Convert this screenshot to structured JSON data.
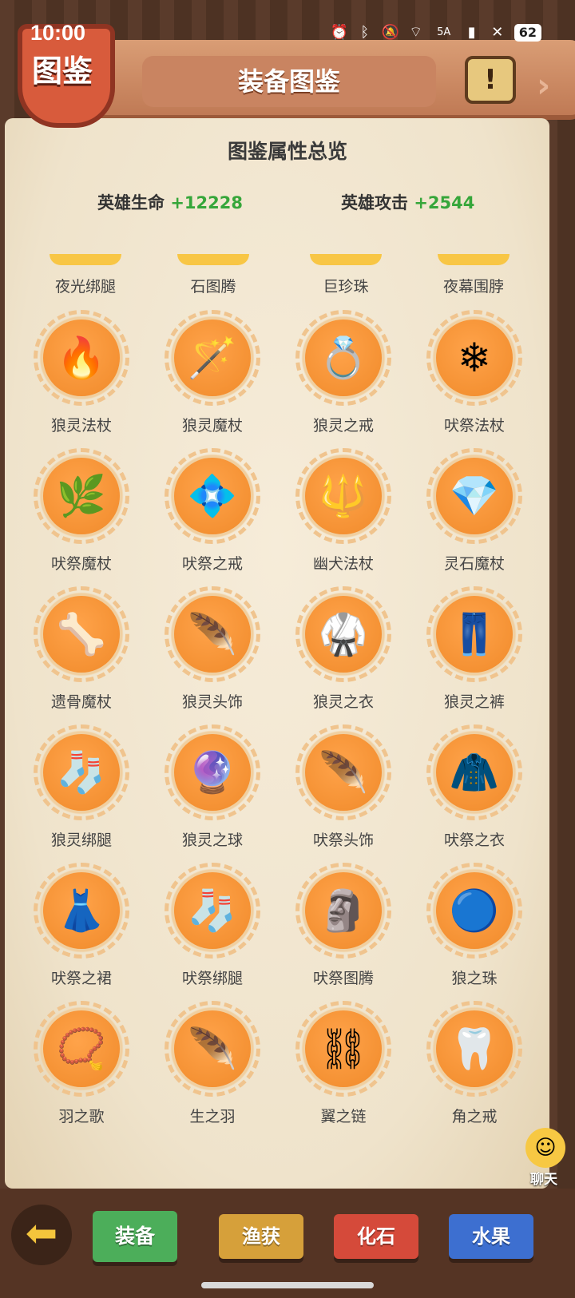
{
  "status_bar": {
    "time": "10:00",
    "network": "5A",
    "battery": "62"
  },
  "header": {
    "badge": "图鉴",
    "title": "装备图鉴",
    "scroll_icon": "!",
    "next_arrow": "›"
  },
  "overview": {
    "title": "图鉴属性总览",
    "hp_label": "英雄生命",
    "hp_value": "+12228",
    "atk_label": "英雄攻击",
    "atk_value": "+2544"
  },
  "top_row": [
    "夜光绑腿",
    "石图腾",
    "巨珍珠",
    "夜幕围脖"
  ],
  "items": [
    {
      "label": "狼灵法杖",
      "icon": "fire-staff-icon",
      "glyph": "🔥"
    },
    {
      "label": "狼灵魔杖",
      "icon": "crystal-wand-icon",
      "glyph": "🪄"
    },
    {
      "label": "狼灵之戒",
      "icon": "fang-ring-icon",
      "glyph": "💍"
    },
    {
      "label": "吠祭法杖",
      "icon": "ice-staff-icon",
      "glyph": "❄"
    },
    {
      "label": "吠祭魔杖",
      "icon": "branch-wand-icon",
      "glyph": "🌿"
    },
    {
      "label": "吠祭之戒",
      "icon": "blue-ring-icon",
      "glyph": "💠"
    },
    {
      "label": "幽犬法杖",
      "icon": "purple-staff-icon",
      "glyph": "🔱"
    },
    {
      "label": "灵石魔杖",
      "icon": "gem-wand-icon",
      "glyph": "💎"
    },
    {
      "label": "遗骨魔杖",
      "icon": "green-staff-icon",
      "glyph": "🦴"
    },
    {
      "label": "狼灵头饰",
      "icon": "wolf-helmet-icon",
      "glyph": "🪶"
    },
    {
      "label": "狼灵之衣",
      "icon": "wolf-robe-icon",
      "glyph": "🥋"
    },
    {
      "label": "狼灵之裤",
      "icon": "wolf-pants-icon",
      "glyph": "👖"
    },
    {
      "label": "狼灵绑腿",
      "icon": "wolf-leggings-icon",
      "glyph": "🧦"
    },
    {
      "label": "狼灵之球",
      "icon": "wolf-orb-icon",
      "glyph": "🔮"
    },
    {
      "label": "吠祭头饰",
      "icon": "ritual-helmet-icon",
      "glyph": "🪶"
    },
    {
      "label": "吠祭之衣",
      "icon": "ritual-robe-icon",
      "glyph": "🧥"
    },
    {
      "label": "吠祭之裙",
      "icon": "ritual-skirt-icon",
      "glyph": "👗"
    },
    {
      "label": "吠祭绑腿",
      "icon": "ritual-leggings-icon",
      "glyph": "🧦"
    },
    {
      "label": "吠祭图腾",
      "icon": "ritual-totem-icon",
      "glyph": "🗿"
    },
    {
      "label": "狼之珠",
      "icon": "wolf-pearl-icon",
      "glyph": "🔵"
    },
    {
      "label": "羽之歌",
      "icon": "feather-necklace-icon",
      "glyph": "📿"
    },
    {
      "label": "生之羽",
      "icon": "green-feather-icon",
      "glyph": "🪶"
    },
    {
      "label": "翼之链",
      "icon": "wing-chain-icon",
      "glyph": "⛓"
    },
    {
      "label": "角之戒",
      "icon": "horn-ring-icon",
      "glyph": "🦷"
    }
  ],
  "chat": {
    "label": "聊天",
    "icon": "chat-bubble-icon"
  },
  "tabs": [
    {
      "label": "装备",
      "color": "#4cae5a",
      "active": true
    },
    {
      "label": "渔获",
      "color": "#d6a03a",
      "active": false
    },
    {
      "label": "化石",
      "color": "#d54a3a",
      "active": false
    },
    {
      "label": "水果",
      "color": "#3d6fd0",
      "active": false
    }
  ],
  "back_button": {
    "icon": "back-arrow-icon",
    "glyph": "⬅"
  }
}
